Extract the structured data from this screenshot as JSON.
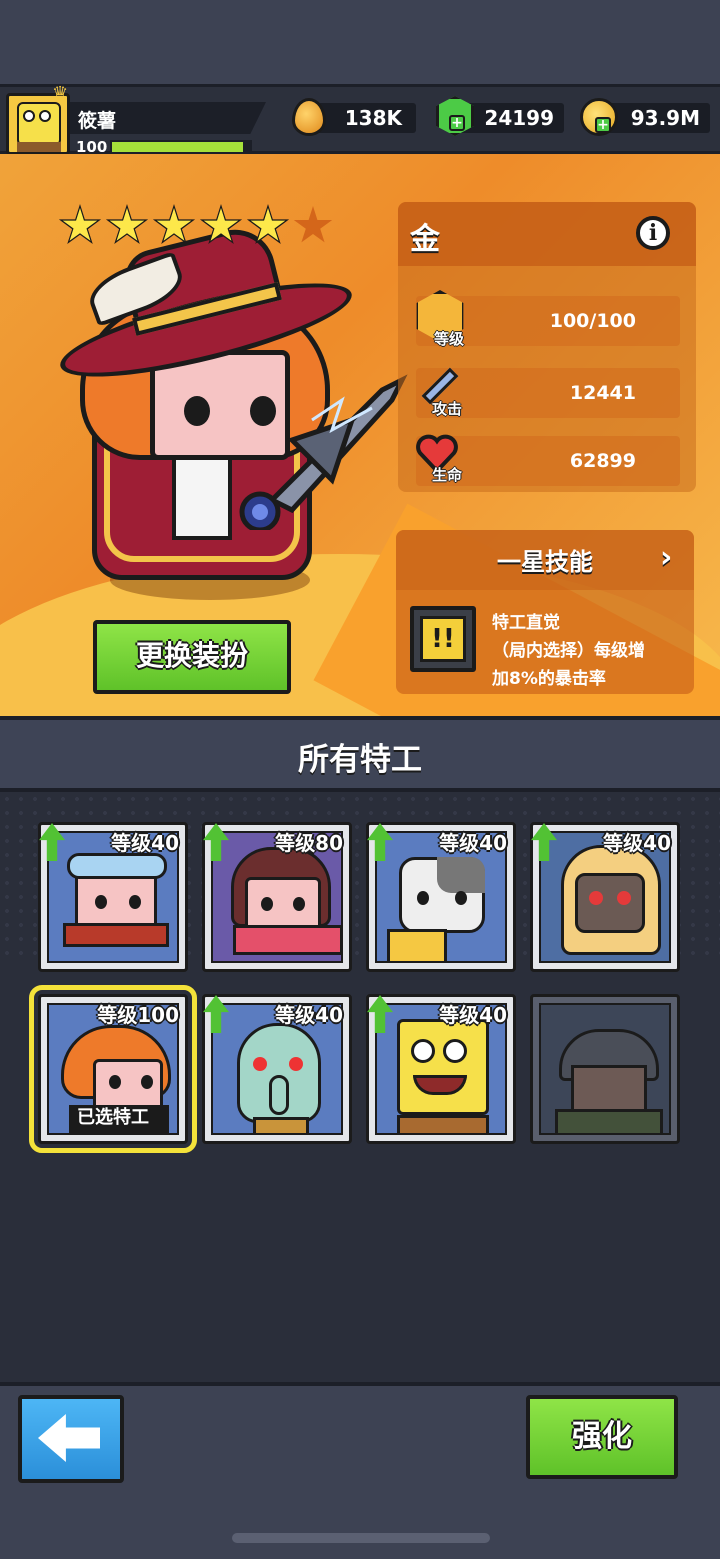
{
  "player": {
    "name": "筱薯",
    "level": "100",
    "xp_fraction": 0.95
  },
  "resources": [
    {
      "icon": "drop-icon",
      "value": "138K"
    },
    {
      "icon": "gem-icon",
      "value": "24199"
    },
    {
      "icon": "coin-icon",
      "value": "93.9M"
    }
  ],
  "hero": {
    "name": "金",
    "stars_filled": 5,
    "stars_total": 6,
    "change_outfit_label": "更换装扮",
    "stats": [
      {
        "label": "等级",
        "value": "100/100",
        "icon": "level-badge-icon"
      },
      {
        "label": "攻击",
        "value": "12441",
        "icon": "sword-icon"
      },
      {
        "label": "生命",
        "value": "62899",
        "icon": "heart-icon"
      }
    ],
    "skill": {
      "title": "一星技能",
      "name": "特工直觉",
      "desc_line1": "（局内选择）每级增",
      "desc_line2": "加8%的暴击率"
    }
  },
  "roster": {
    "title": "所有特工",
    "agents": [
      {
        "level": "等级40",
        "upgradable": true
      },
      {
        "level": "等级80",
        "upgradable": true
      },
      {
        "level": "等级40",
        "upgradable": true
      },
      {
        "level": "等级40",
        "upgradable": true
      },
      {
        "level": "等级100",
        "upgradable": false,
        "selected": true,
        "selected_label": "已选特工"
      },
      {
        "level": "等级40",
        "upgradable": true
      },
      {
        "level": "等级40",
        "upgradable": true
      },
      {
        "level": "",
        "upgradable": false,
        "locked": true
      }
    ]
  },
  "footer": {
    "upgrade_label": "强化"
  },
  "colors": {
    "accent_green": "#5fc229",
    "panel_orange": "#ee8c2a",
    "back_blue": "#2b8fd9",
    "selected_yellow": "#f4e23a"
  }
}
